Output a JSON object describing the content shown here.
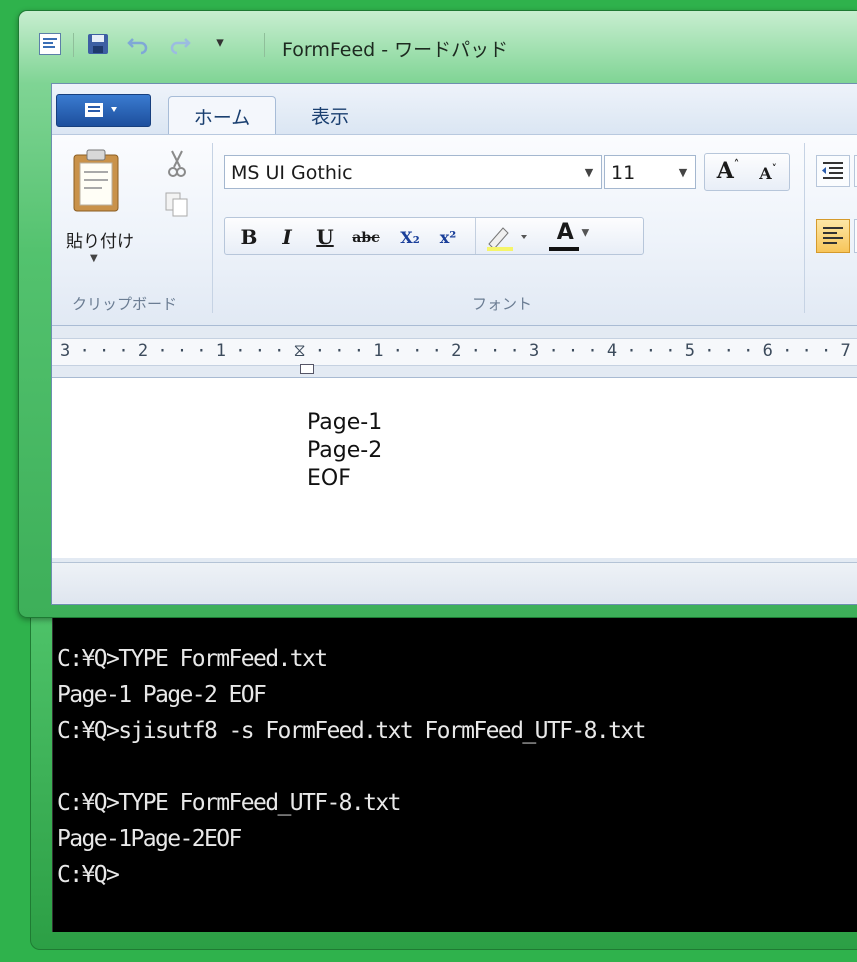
{
  "wordpad": {
    "title": "FormFeed - ワードパッド",
    "tabs": [
      {
        "label": "ホーム",
        "active": true
      },
      {
        "label": "表示",
        "active": false
      }
    ],
    "clipboard": {
      "paste_label": "貼り付け",
      "group_label": "クリップボード"
    },
    "font": {
      "name": "MS UI Gothic",
      "size": "11",
      "group_label": "フォント",
      "bold": "B",
      "italic": "I",
      "underline": "U",
      "strike": "abc",
      "subscript": "X₂",
      "superscript": "x²",
      "grow": "A",
      "shrink": "A",
      "color_letter": "A"
    },
    "ruler_text": "3 · · · 2 · · · 1 · · · ⧖ · · · 1 · · · 2 · · · 3 · · · 4 · · · 5 · · · 6 · · · 7 ·",
    "document_lines": [
      "Page-1",
      "Page-2",
      "EOF"
    ]
  },
  "console": {
    "lines": [
      "C:¥Q>TYPE FormFeed.txt",
      "Page-1 Page-2 EOF",
      "C:¥Q>sjisutf8 -s FormFeed.txt FormFeed_UTF-8.txt",
      "",
      "C:¥Q>TYPE FormFeed_UTF-8.txt",
      "Page-1Page-2EOF",
      "C:¥Q>"
    ]
  },
  "colors": {
    "desktop_green": "#2fb24c",
    "console_bg": "#000000",
    "console_text": "#e8e8e8",
    "app_menu_blue": "#1d4f9d"
  }
}
